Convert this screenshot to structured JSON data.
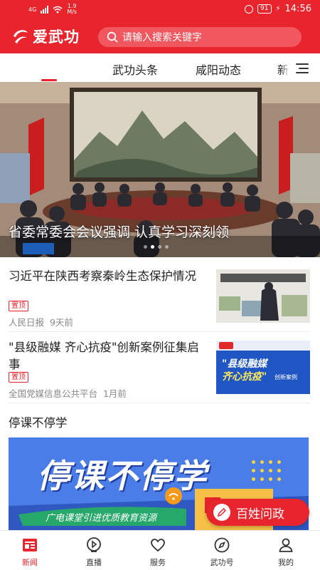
{
  "status_bar": {
    "network": "4G",
    "speed_value": "1.9",
    "speed_unit": "M/s",
    "battery": "91",
    "time": "14:56"
  },
  "header": {
    "logo_text": "爱武功",
    "search_placeholder": "请输入搜索关键字",
    "brand_color": "#e8242d"
  },
  "tabs": {
    "items": [
      {
        "label": "武功头条"
      },
      {
        "label": "咸阳动态"
      },
      {
        "label": "新"
      }
    ],
    "menu_icon": "hamburger-icon"
  },
  "banner": {
    "title": "省委常委会会议强调 认真学习深刻领",
    "page_count": 4,
    "active_index": 1
  },
  "news": [
    {
      "title": "习近平在陕西考察秦岭生态保护情况",
      "tag": "置顶",
      "source": "人民日报",
      "time": "9天前"
    },
    {
      "title": "\"县级融媒 齐心抗疫\"创新案例征集启事",
      "tag": "置顶",
      "source": "全国党媒信息公共平台",
      "time": "1月前",
      "thumb_caption_1": "\"县级融媒",
      "thumb_caption_2": "齐心抗疫\"",
      "thumb_caption_3": "创新案例"
    }
  ],
  "section": {
    "title": "停课不停学",
    "promo_title": "停课不停学",
    "promo_subtitle": "广电课堂引进优质教育资源"
  },
  "float_button": {
    "label": "百姓问政"
  },
  "bottom_nav": [
    {
      "label": "新闻",
      "icon": "news-icon",
      "active": true
    },
    {
      "label": "直播",
      "icon": "live-icon",
      "active": false
    },
    {
      "label": "服务",
      "icon": "service-icon",
      "active": false
    },
    {
      "label": "武功号",
      "icon": "compass-icon",
      "active": false
    },
    {
      "label": "我的",
      "icon": "user-icon",
      "active": false
    }
  ]
}
